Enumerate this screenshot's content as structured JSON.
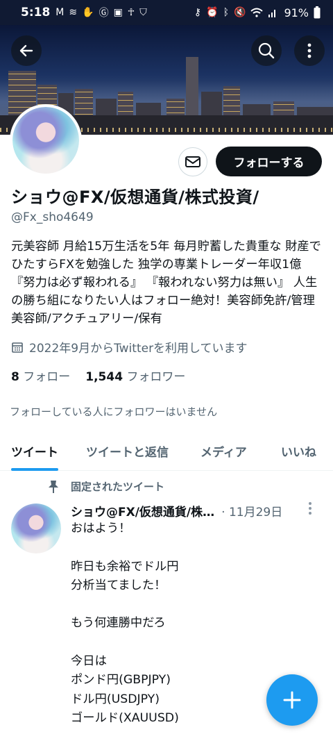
{
  "status_bar": {
    "time": "5:18",
    "left_icons": [
      "gmail-icon",
      "signal-wave-icon",
      "hand-icon",
      "g-icon",
      "gallery-icon",
      "accessibility-icon",
      "shield-icon"
    ],
    "right_icons": [
      "key-icon",
      "alarm-icon",
      "bluetooth-icon",
      "mute-icon",
      "wifi-icon",
      "signal-icon"
    ],
    "battery": "91%"
  },
  "header": {
    "back_icon": "back-arrow-icon",
    "search_icon": "search-icon",
    "more_icon": "more-vertical-icon"
  },
  "profile": {
    "name": "ショウ@FX/仮想通貨/株式投資/",
    "handle": "@Fx_sho4649",
    "follow_label": "フォローする",
    "message_icon": "mail-icon",
    "bio": "元美容師 月給15万生活を5年 毎月貯蓄した貴重な 財産でひたすらFXを勉強した 独学の専業トレーダー年収1億 『努力は必ず報われる』 『報われない努力は無い』 人生の勝ち組になりたい人はフォロー絶対！美容師免許/管理美容師/アクチュアリー/保有",
    "joined": "2022年9月からTwitterを利用しています",
    "following_count": "8",
    "following_label": "フォロー",
    "followers_count": "1,544",
    "followers_label": "フォロワー",
    "mutual_note": "フォローしている人にフォロワーはいません"
  },
  "tabs": [
    {
      "label": "ツイート",
      "active": true
    },
    {
      "label": "ツイートと返信",
      "active": false
    },
    {
      "label": "メディア",
      "active": false
    },
    {
      "label": "いいね",
      "active": false
    }
  ],
  "pinned_tweet": {
    "pinned_label": "固定されたツイート",
    "author": "ショウ@FX/仮想通貨/株…",
    "date": "· 11月29日",
    "text": "おはよう！\n\n昨日も余裕でドル円\n分析当てました！\n\nもう何連勝中だろ\n\n今日は\nポンド円(GBPJPY)\nドル円(USDJPY)\nゴールド(XAUUSD)"
  },
  "fab": {
    "icon": "compose-plus-icon"
  },
  "colors": {
    "accent": "#1d9bf0",
    "text": "#0f1419",
    "muted": "#536471"
  }
}
